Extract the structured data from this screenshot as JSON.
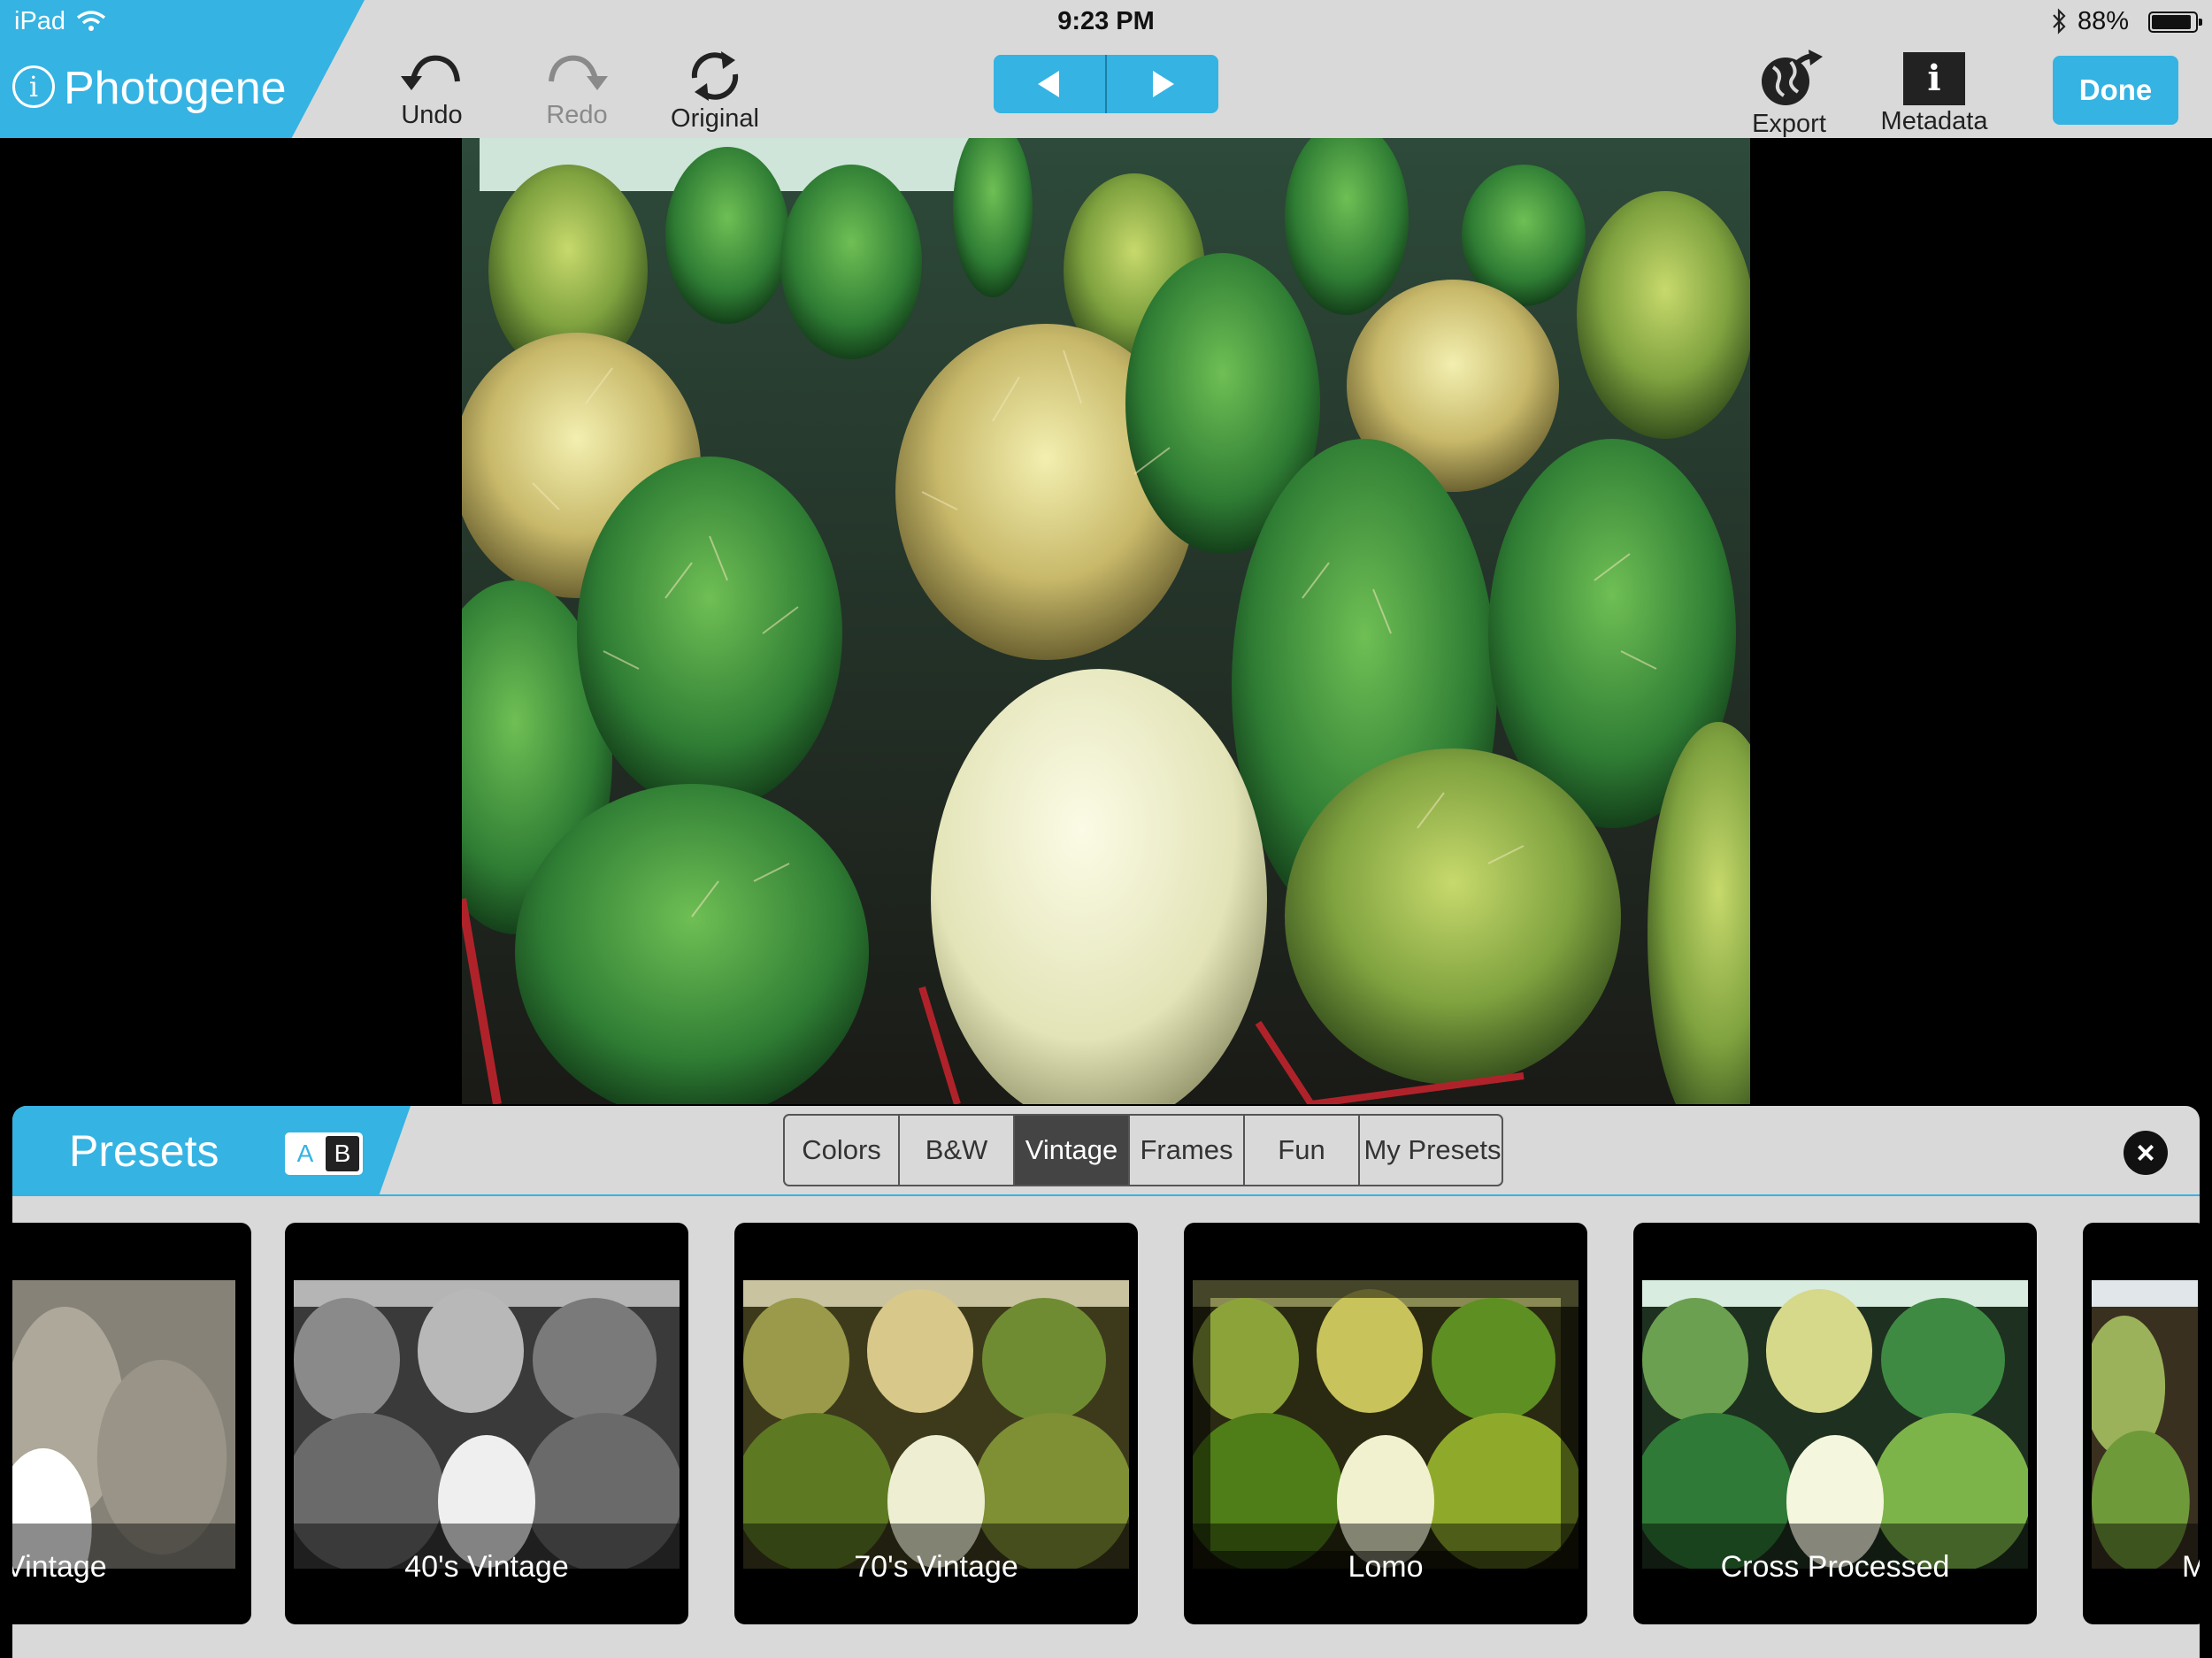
{
  "status_bar": {
    "device": "iPad",
    "time": "9:23 PM",
    "battery": "88%"
  },
  "app": {
    "name": "Photogene"
  },
  "toolbar": {
    "undo": "Undo",
    "redo": "Redo",
    "original": "Original",
    "export": "Export",
    "metadata": "Metadata",
    "done": "Done"
  },
  "presets": {
    "title": "Presets",
    "ab_a": "A",
    "ab_b": "B",
    "categories": [
      "Colors",
      "B&W",
      "Vintage",
      "Frames",
      "Fun",
      "My Presets"
    ],
    "active_category": "Vintage",
    "items": [
      "Vintage",
      "40's Vintage",
      "70's Vintage",
      "Lomo",
      "Cross Processed",
      "M"
    ]
  },
  "colors": {
    "accent": "#35b3e2",
    "toolbar_bg": "#d9d9d9"
  },
  "icons": {
    "undo": "undo-icon",
    "redo": "redo-icon",
    "original": "revert-icon",
    "export": "globe-export-icon",
    "metadata": "info-icon",
    "prev": "triangle-left-icon",
    "next": "triangle-right-icon",
    "close": "close-icon"
  }
}
